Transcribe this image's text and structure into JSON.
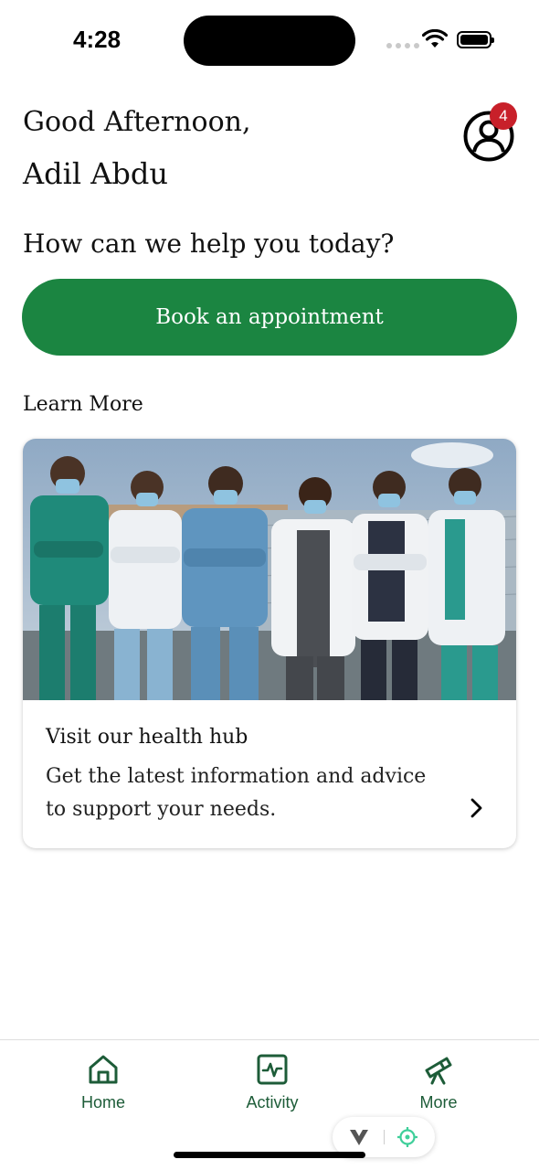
{
  "status_bar": {
    "time": "4:28"
  },
  "header": {
    "greeting": "Good Afternoon,",
    "user_name": "Adil Abdu",
    "notification_count": "4"
  },
  "main": {
    "question": "How can we help you today?",
    "book_button_label": "Book an appointment",
    "learn_more_label": "Learn More",
    "card": {
      "title": "Visit our health hub",
      "description": "Get the latest information and advice to support your needs."
    }
  },
  "tab_bar": {
    "tabs": [
      {
        "label": "Home",
        "icon": "home-icon"
      },
      {
        "label": "Activity",
        "icon": "activity-icon"
      },
      {
        "label": "More",
        "icon": "telescope-icon"
      }
    ]
  },
  "colors": {
    "primary_green": "#1b8541",
    "tab_green": "#1d5c38",
    "badge_red": "#c8202a"
  }
}
